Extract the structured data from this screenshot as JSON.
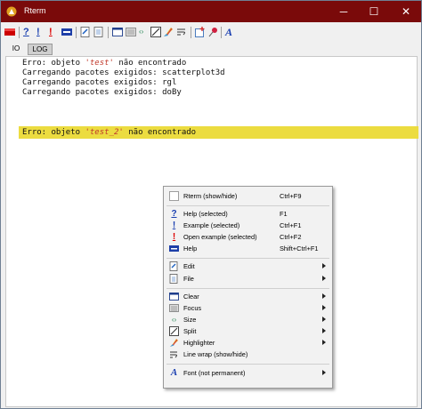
{
  "window": {
    "title": "Rterm",
    "minimize_glyph": "─",
    "maximize_glyph": "☐",
    "close_glyph": "✕"
  },
  "toolbar": {
    "icons": [
      "stop-icon",
      "help-selected-icon",
      "example-selected-icon",
      "open-example-icon",
      "html-help-icon",
      "edit-icon",
      "file-icon",
      "clear-icon",
      "focus-icon",
      "size-icon",
      "split-icon",
      "highlighter-icon",
      "line-wrap-icon",
      "new-icon",
      "pin-icon",
      "font-icon"
    ],
    "glyphs": {
      "help": "?",
      "example": "!",
      "font": "A",
      "size": "‹›"
    }
  },
  "tabs": [
    {
      "label": "IO"
    },
    {
      "label": "LOG"
    }
  ],
  "console": {
    "lines": [
      {
        "before": "Erro: objeto ",
        "obj": "'test'",
        "after": " não encontrado"
      },
      {
        "before": "Carregando pacotes exigidos: scatterplot3d",
        "obj": "",
        "after": ""
      },
      {
        "before": "Carregando pacotes exigidos: rgl",
        "obj": "",
        "after": ""
      },
      {
        "before": "Carregando pacotes exigidos: doBy",
        "obj": "",
        "after": ""
      },
      {
        "before": "Erro: objeto ",
        "obj": "'test_2'",
        "after": " não encontrado"
      }
    ]
  },
  "menu": {
    "items": [
      {
        "label": "Rterm (show/hide)",
        "shortcut": "Ctrl+F9"
      },
      {
        "label": "Help (selected)",
        "shortcut": "F1"
      },
      {
        "label": "Example (selected)",
        "shortcut": "Ctrl+F1"
      },
      {
        "label": "Open example (selected)",
        "shortcut": "Ctrl+F2"
      },
      {
        "label": "Help",
        "shortcut": "Shift+Ctrl+F1"
      },
      {
        "label": "Edit",
        "shortcut": ""
      },
      {
        "label": "File",
        "shortcut": ""
      },
      {
        "label": "Clear",
        "shortcut": ""
      },
      {
        "label": "Focus",
        "shortcut": ""
      },
      {
        "label": "Size",
        "shortcut": ""
      },
      {
        "label": "Split",
        "shortcut": ""
      },
      {
        "label": "Highlighter",
        "shortcut": ""
      },
      {
        "label": "Line wrap (show/hide)",
        "shortcut": ""
      },
      {
        "label": "Font (not permanent)",
        "shortcut": ""
      }
    ]
  },
  "colors": {
    "titlebar": "#7a0a0a",
    "highlight": "#ecdc40",
    "object_text": "#c0392b"
  }
}
